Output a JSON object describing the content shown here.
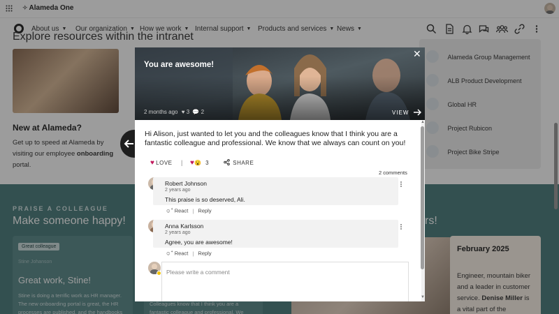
{
  "app": {
    "title": "Alameda One"
  },
  "nav": {
    "items": [
      "About us",
      "Our organization",
      "How we work",
      "Internal support",
      "Products and services",
      "News"
    ]
  },
  "background": {
    "explore_heading": "Explore resources within the intranet",
    "new_title": "New at Alameda?",
    "new_text_1": "Get up to speed at Alameda by",
    "new_text_2": "visiting our employee ",
    "new_text_bold": "onboarding",
    "new_text_3": "portal.",
    "sites": [
      "Alameda Group Management",
      "ALB Product Development",
      "Global HR",
      "Project Rubicon",
      "Project Bike Stripe"
    ],
    "praise_kicker": "PRAISE A COLLEAGUE",
    "praise_heading": "Make someone happy!",
    "card_badge": "Great colleague",
    "card_meta": "Stine Johanson",
    "card_title": "Great work, Stine!",
    "card_text_1": "Stine is doing a terrific work as HR manager.",
    "card_text_2": "The new onboarding portal is great, the HR",
    "card_text_3": "processes are published, and the handbooks",
    "card2_text_1": "Colleagues know that I think you are a",
    "card2_text_2": "fantastic colleague and professional. We",
    "right_heading_tail": "rs!",
    "event_month": "February 2025",
    "event_text_1": "Engineer, mountain biker",
    "event_text_2": "and a leader in customer",
    "event_text_3": "service. ",
    "event_name": "Denise Miller",
    "event_text_4": " is",
    "event_text_5": "a vital part of the"
  },
  "modal": {
    "hero_title": "You are awesome!",
    "hero_time": "2 months ago",
    "hero_likes": "3",
    "hero_comments": "2",
    "view_label": "VIEW",
    "message": "Hi Alison, just wanted to let you and the colleagues know that I think you are a fantastic colleague and professional. We know that we always can count on you!",
    "love_label": "LOVE",
    "reaction_count": "3",
    "share_label": "SHARE",
    "comments_count": "2 comments",
    "comments": [
      {
        "author": "Robert Johnson",
        "time": "2 years ago",
        "text": "This praise is so deserved, Ali."
      },
      {
        "author": "Anna Karlsson",
        "time": "2 years ago",
        "text": "Agree, you are awesome!"
      }
    ],
    "react_label": "React",
    "reply_label": "Reply",
    "comment_placeholder": "Please write a comment"
  },
  "colors": {
    "teal": "#4a7c7d",
    "love": "#c2185b",
    "overlay": "rgba(20,20,20,0.42)"
  },
  "icons": [
    "apps-grid-icon",
    "logo-icon",
    "search-icon",
    "document-icon",
    "bell-icon",
    "chat-icon",
    "people-icon",
    "link-icon",
    "more-icon",
    "close-icon",
    "arrow-right-icon",
    "arrow-left-icon",
    "heart-icon",
    "share-icon",
    "react-icon"
  ]
}
